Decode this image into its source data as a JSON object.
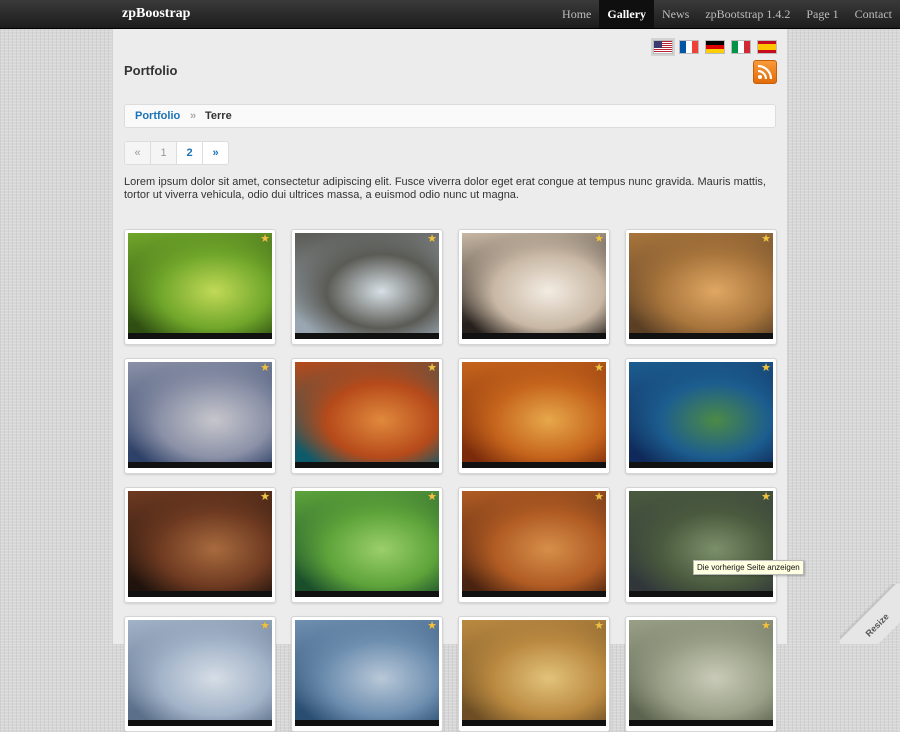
{
  "navbar": {
    "brand": "zpBoostrap",
    "items": [
      {
        "label": "Home",
        "active": false
      },
      {
        "label": "Gallery",
        "active": true
      },
      {
        "label": "News",
        "active": false
      },
      {
        "label": "zpBootstrap 1.4.2",
        "active": false
      },
      {
        "label": "Page 1",
        "active": false
      },
      {
        "label": "Contact",
        "active": false
      }
    ]
  },
  "page": {
    "title": "Portfolio",
    "languages": [
      "en-us-flag-icon",
      "fr-flag-icon",
      "de-flag-icon",
      "it-flag-icon",
      "es-flag-icon"
    ],
    "rss_icon": "rss-icon"
  },
  "breadcrumb": {
    "parent": "Portfolio",
    "separator": "»",
    "current": "Terre"
  },
  "pagination": {
    "prev": "«",
    "pages": [
      "1",
      "2"
    ],
    "current": "1",
    "next": "»"
  },
  "description": "Lorem ipsum dolor sit amet, consectetur adipiscing elit. Fusce viverra dolor eget erat congue at tempus nunc gravida. Mauris mattis, tortor ut viverra vehicula, odio dui ultrices massa, a euismod odio nunc ut magna.",
  "gallery": {
    "star_icon": "star-icon",
    "thumbnails": [
      {
        "name": "green-terraced-hills",
        "colors": [
          "#2f4f12",
          "#6fa62a",
          "#c2d957"
        ]
      },
      {
        "name": "crater-lake-volcano",
        "colors": [
          "#9aa7b2",
          "#5b5b55",
          "#d7e0e6"
        ]
      },
      {
        "name": "snowy-mountain-ridge",
        "colors": [
          "#27211d",
          "#c8b7a4",
          "#f3ece2"
        ]
      },
      {
        "name": "mosque-city-aerial",
        "colors": [
          "#5a3f25",
          "#a8753c",
          "#e0a763"
        ]
      },
      {
        "name": "christ-redeemer-bay",
        "colors": [
          "#2e4168",
          "#8b91a7",
          "#c6c6cc"
        ]
      },
      {
        "name": "red-rock-island",
        "colors": [
          "#0d5a6a",
          "#b64a1a",
          "#e0893d"
        ]
      },
      {
        "name": "autumn-forest",
        "colors": [
          "#7b2b0b",
          "#c5641c",
          "#e7a84a"
        ]
      },
      {
        "name": "green-island-aerial",
        "colors": [
          "#0f2a5a",
          "#1c5d8f",
          "#4c8a46"
        ]
      },
      {
        "name": "petra-monastery",
        "colors": [
          "#20130d",
          "#6e3a21",
          "#a86b3e"
        ]
      },
      {
        "name": "green-crater",
        "colors": [
          "#1a4e2b",
          "#5da33a",
          "#9bcf6b"
        ]
      },
      {
        "name": "desert-canyon",
        "colors": [
          "#4a2310",
          "#b05b23",
          "#d68f4a"
        ]
      },
      {
        "name": "mountain-valley",
        "colors": [
          "#30363a",
          "#4a5a3e",
          "#7c8f6a"
        ]
      },
      {
        "name": "cloudy-landscape",
        "colors": [
          "#5b6f8a",
          "#a2b3c8",
          "#d6dde6"
        ]
      },
      {
        "name": "mist-coast",
        "colors": [
          "#2a4e72",
          "#6f8fb0",
          "#b8c8d8"
        ]
      },
      {
        "name": "golden-plains",
        "colors": [
          "#6d4e24",
          "#bb8a41",
          "#e2c27a"
        ]
      },
      {
        "name": "stone-pebbles",
        "colors": [
          "#5c6450",
          "#9aa087",
          "#c9cbb8"
        ]
      }
    ]
  },
  "tooltip": "Die vorherige Seite anzeigen",
  "resize_label": "Resize"
}
